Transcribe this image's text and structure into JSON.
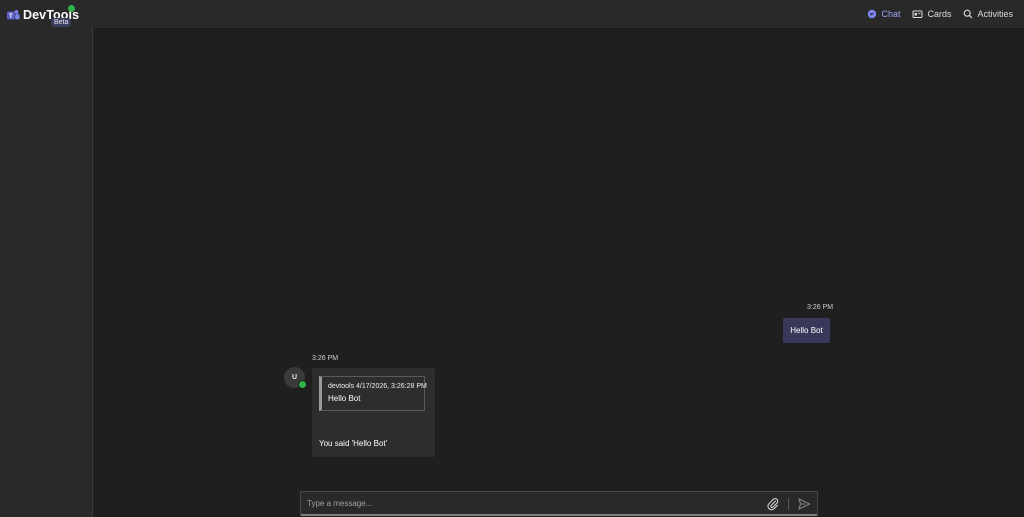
{
  "app": {
    "name": "DevTools",
    "badge": "Beta",
    "status_color": "#2fb34a"
  },
  "nav": {
    "items": [
      {
        "label": "Chat",
        "icon": "chat-icon",
        "active": true
      },
      {
        "label": "Cards",
        "icon": "cards-icon",
        "active": false
      },
      {
        "label": "Activities",
        "icon": "search-icon",
        "active": false
      }
    ],
    "accent_color": "#9ea3f5"
  },
  "conversation": {
    "user_message": {
      "time": "3:26 PM",
      "text": "Hello Bot"
    },
    "bot_message": {
      "time": "3:26 PM",
      "avatar_initial": "U",
      "quote": {
        "meta": "devtools 4/17/2026, 3:26:28 PM",
        "text": "Hello Bot"
      },
      "reply": "You said 'Hello Bot'"
    }
  },
  "composer": {
    "placeholder": "Type a message...",
    "value": "",
    "attach_icon": "paperclip-icon",
    "send_icon": "send-icon"
  }
}
